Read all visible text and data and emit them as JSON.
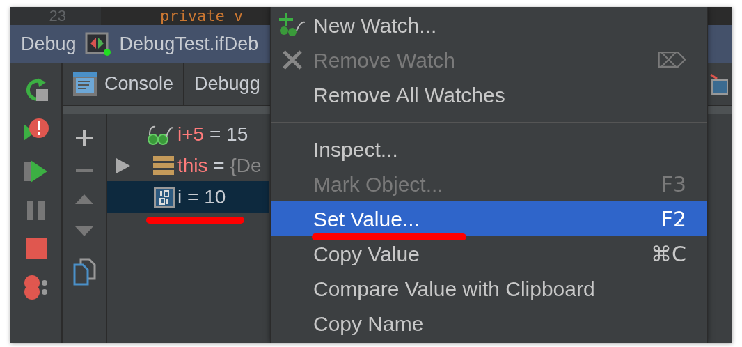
{
  "editor": {
    "line_number": "23",
    "code": "private v"
  },
  "debug_bar": {
    "title": "Debug",
    "configuration": "DebugTest.ifDeb"
  },
  "tabs": [
    {
      "label": "Console",
      "selected": false
    },
    {
      "label": "Debugg",
      "selected": false
    }
  ],
  "tree": [
    {
      "kind": "watch",
      "name": "i+5",
      "operator": "=",
      "value": "15",
      "expandable": false,
      "selected": false,
      "underlined": false
    },
    {
      "kind": "object",
      "name": "this",
      "operator": "=",
      "value": "{De",
      "expandable": true,
      "selected": false,
      "underlined": false
    },
    {
      "kind": "primitive",
      "name": "i",
      "operator": "=",
      "value": "10",
      "expandable": false,
      "selected": true,
      "underlined": true
    }
  ],
  "context_menu": [
    {
      "kind": "item",
      "label": "New Watch...",
      "disabled": false,
      "selected": false,
      "underlined": false
    },
    {
      "kind": "item",
      "label": "Remove Watch",
      "shortcut": "⌦",
      "disabled": true,
      "selected": false,
      "underlined": false
    },
    {
      "kind": "item",
      "label": "Remove All Watches",
      "disabled": false,
      "selected": false,
      "underlined": false
    },
    {
      "kind": "separator"
    },
    {
      "kind": "item",
      "label": "Inspect...",
      "disabled": false,
      "selected": false,
      "underlined": false
    },
    {
      "kind": "item",
      "label": "Mark Object...",
      "shortcut": "F3",
      "disabled": true,
      "selected": false,
      "underlined": false
    },
    {
      "kind": "item",
      "label": "Set Value...",
      "shortcut": "F2",
      "disabled": false,
      "selected": true,
      "underlined": true
    },
    {
      "kind": "item",
      "label": "Copy Value",
      "shortcut": "⌘C",
      "disabled": false,
      "selected": false,
      "underlined": false
    },
    {
      "kind": "item",
      "label": "Compare Value with Clipboard",
      "disabled": false,
      "selected": false,
      "underlined": false
    },
    {
      "kind": "item",
      "label": "Copy Name",
      "disabled": false,
      "selected": false,
      "underlined": false
    }
  ]
}
